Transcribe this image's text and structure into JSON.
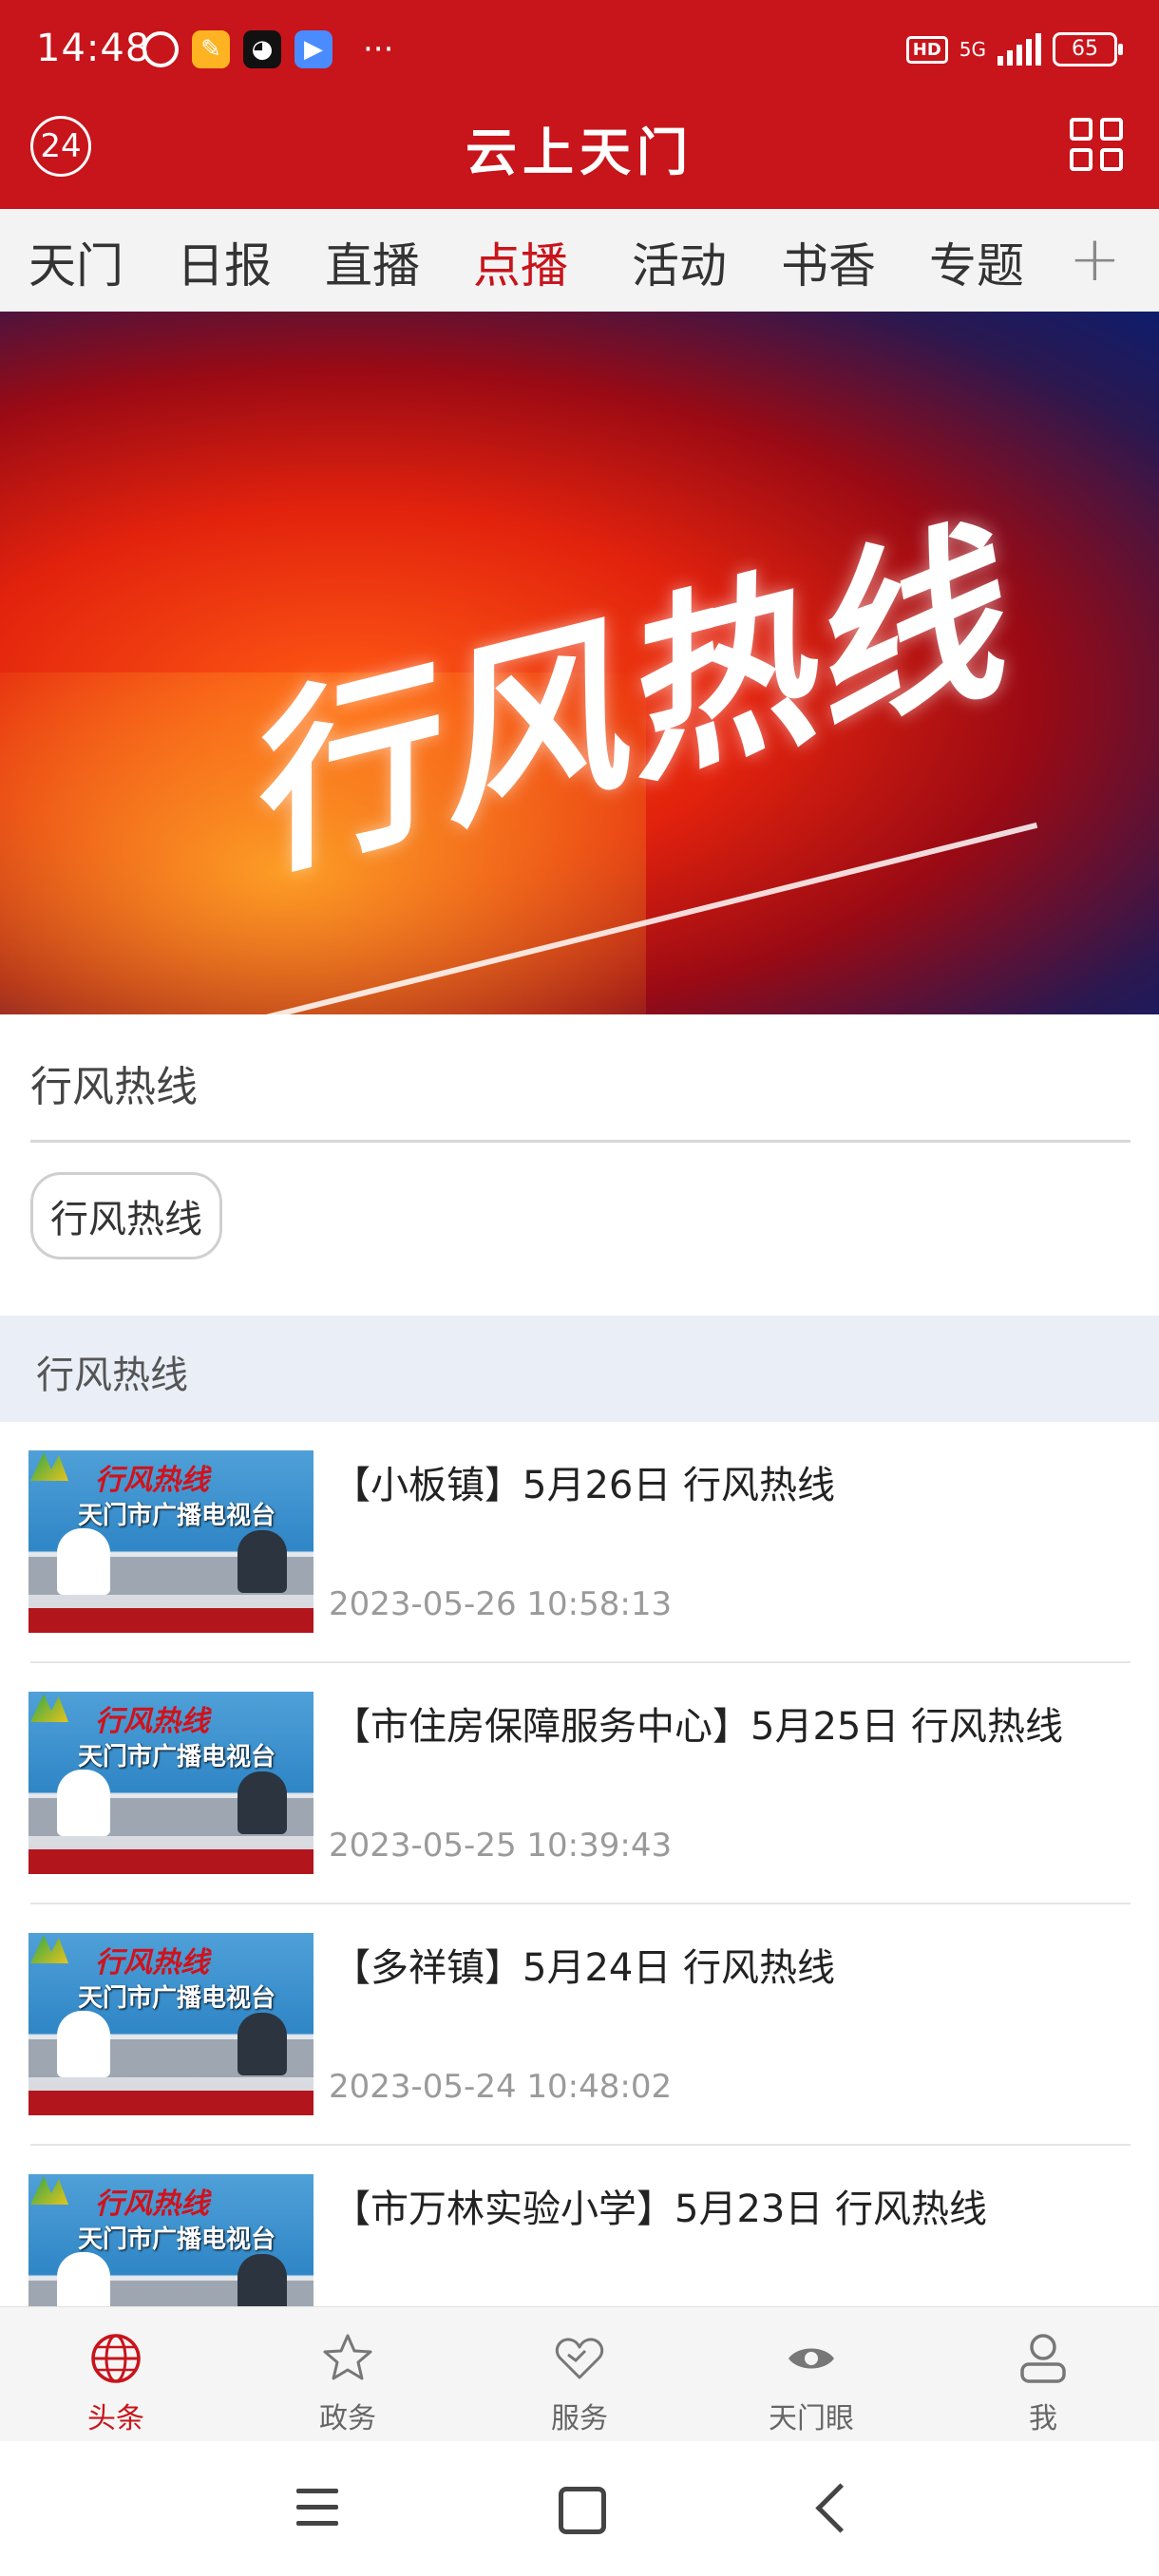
{
  "status": {
    "time": "14:48",
    "hd": "HD",
    "network": "5G",
    "battery": "65",
    "more": "···"
  },
  "header": {
    "badge": "24",
    "title": "云上天门"
  },
  "tabs": [
    "天门",
    "日报",
    "直播",
    "点播",
    "活动",
    "书香",
    "专题"
  ],
  "active_tab": "点播",
  "tabs_add": "+",
  "hero": {
    "sub": "",
    "title": "行风热线"
  },
  "video": {
    "title": "行风热线",
    "chip": "行风热线"
  },
  "section": {
    "label": "行风热线"
  },
  "thumb": {
    "show": "行风热线",
    "station": "天门市广播电视台"
  },
  "items": [
    {
      "title": "【小板镇】5月26日 行风热线",
      "time": "2023-05-26 10:58:13"
    },
    {
      "title": "【市住房保障服务中心】5月25日 行风热线",
      "time": "2023-05-25 10:39:43"
    },
    {
      "title": "【多祥镇】5月24日 行风热线",
      "time": "2023-05-24 10:48:02"
    },
    {
      "title": "【市万林实验小学】5月23日 行风热线",
      "time": ""
    }
  ],
  "bottom_nav": [
    {
      "label": "头条",
      "icon": "globe-icon",
      "active": true
    },
    {
      "label": "政务",
      "icon": "star-icon",
      "active": false
    },
    {
      "label": "服务",
      "icon": "heart-icon",
      "active": false
    },
    {
      "label": "天门眼",
      "icon": "eye-icon",
      "active": false
    },
    {
      "label": "我",
      "icon": "user-icon",
      "active": false
    }
  ],
  "colors": {
    "brand_red": "#c8141b",
    "section_bg": "#eaeef6",
    "time_gray": "#9a9a9a"
  }
}
